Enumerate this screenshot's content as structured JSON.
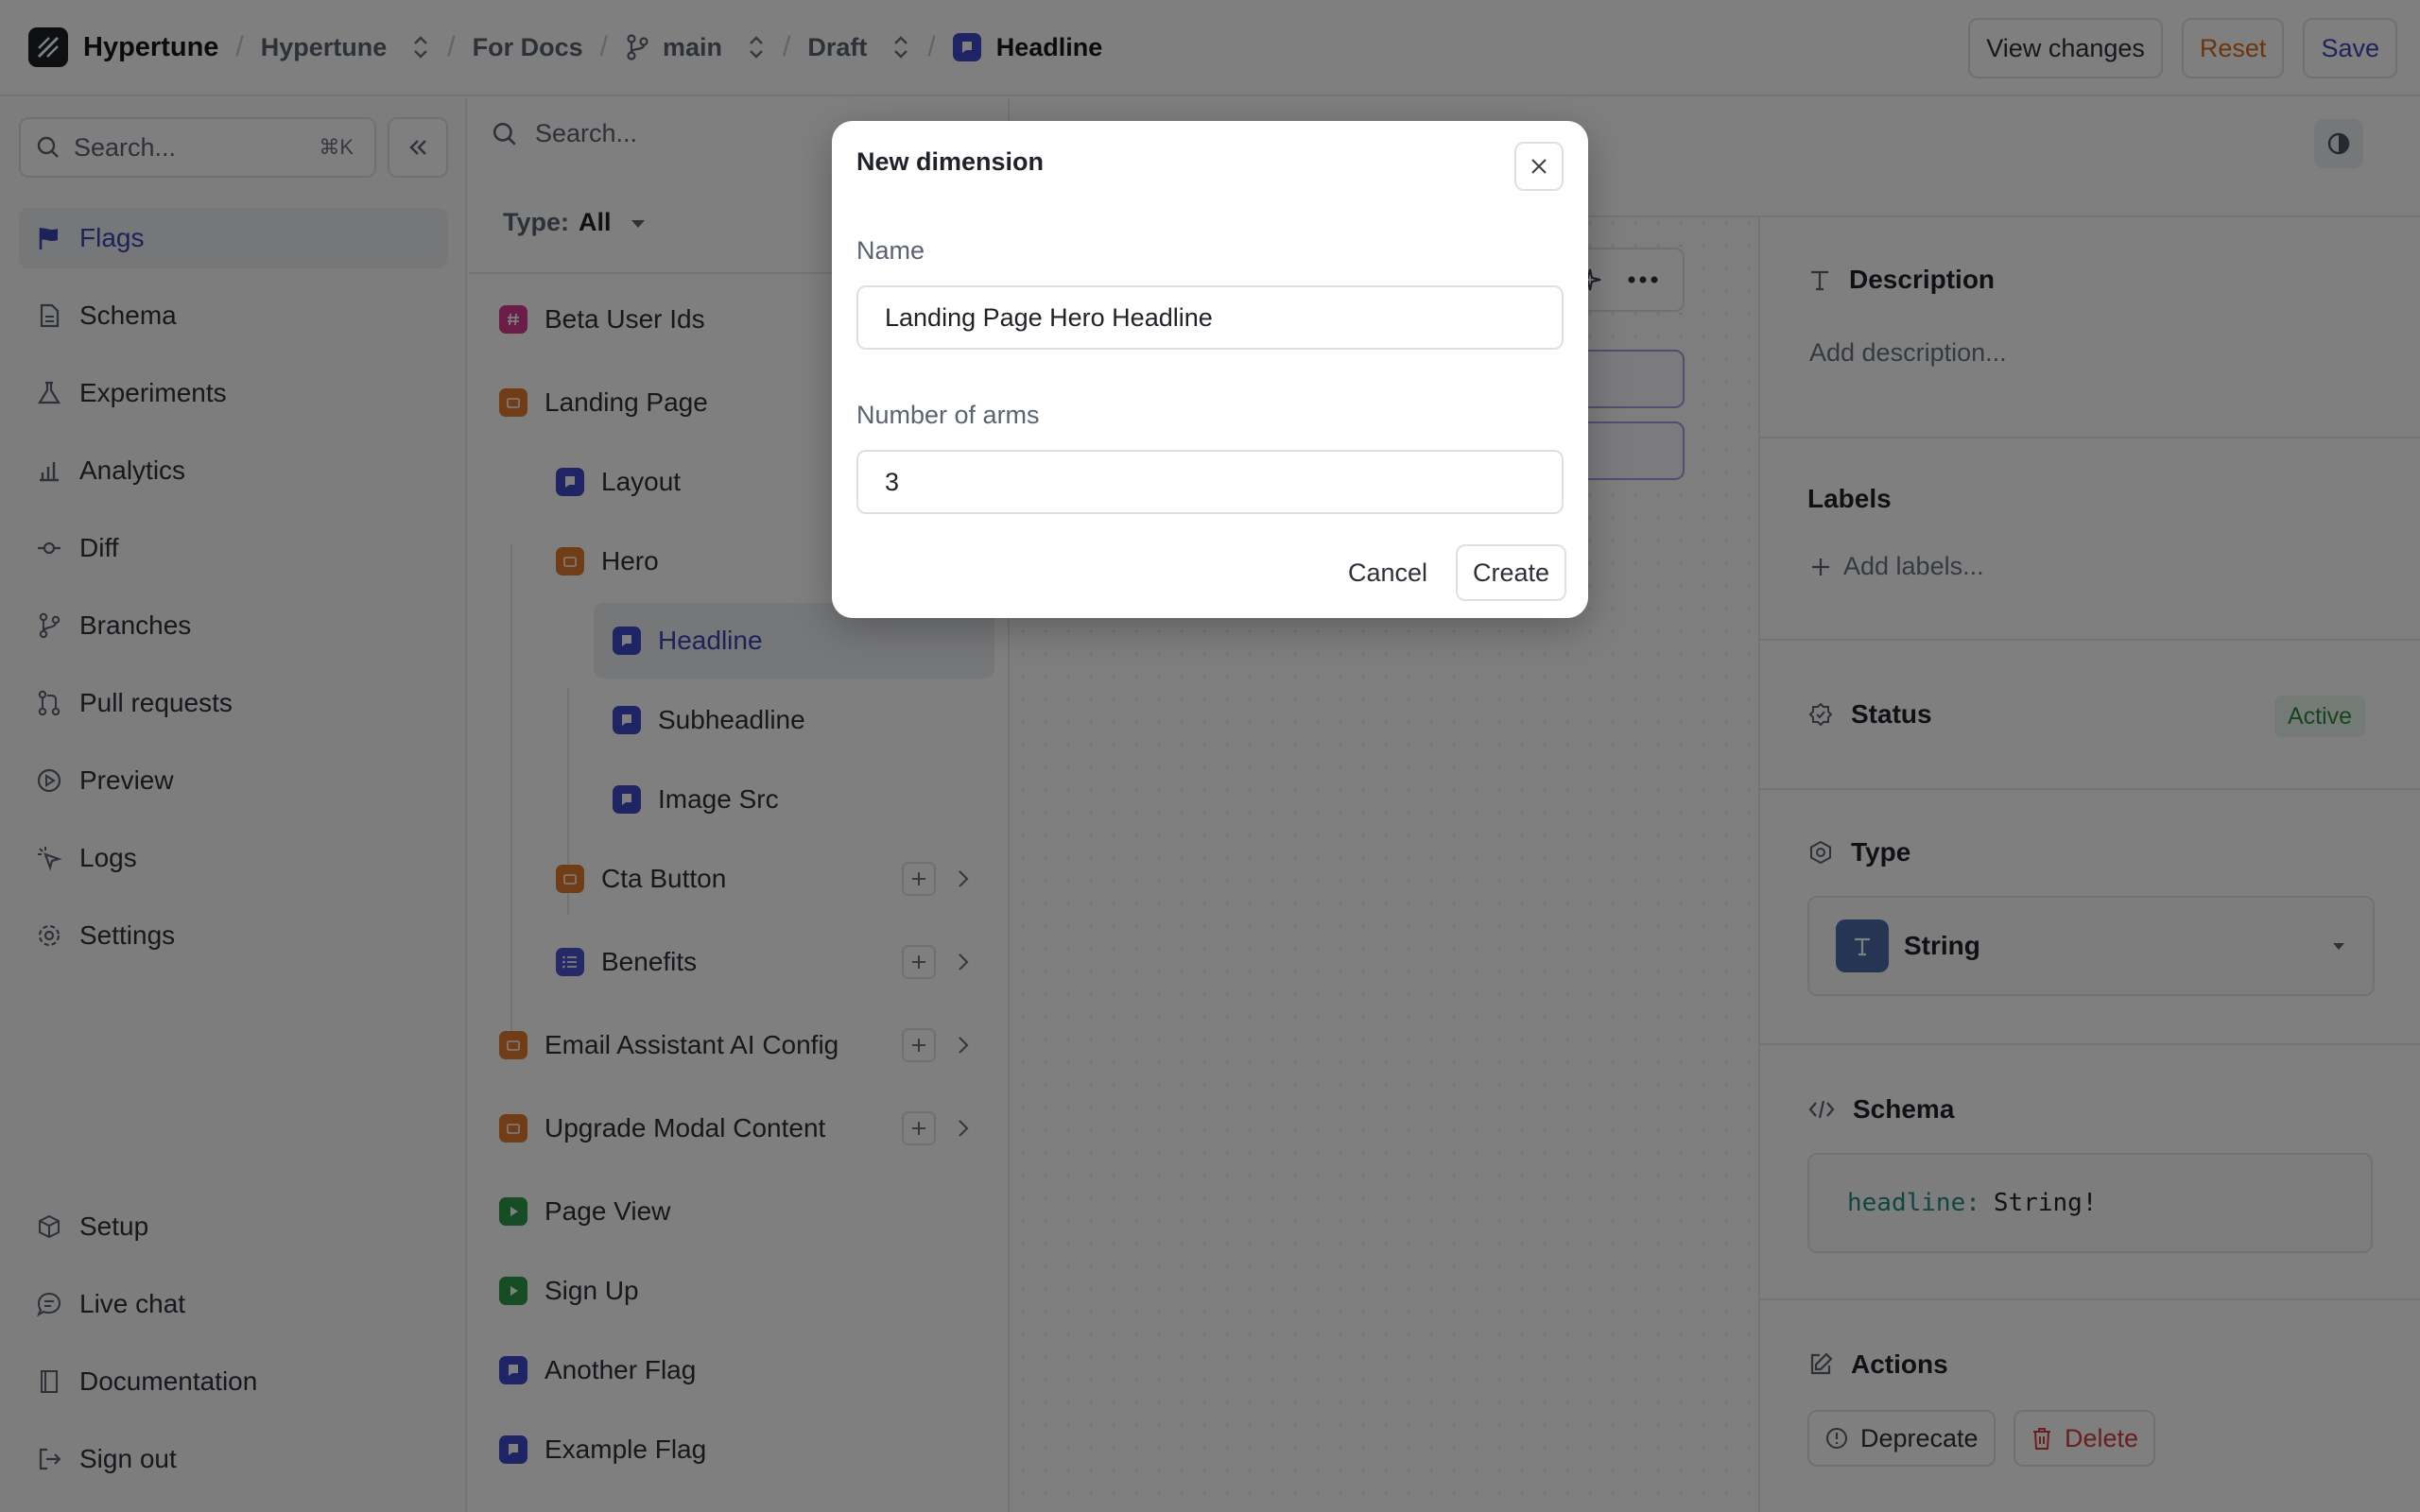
{
  "topbar": {
    "app_name": "Hypertune",
    "project": "Hypertune",
    "section": "For Docs",
    "branch": "main",
    "state": "Draft",
    "current_flag": "Headline",
    "view_changes": "View changes",
    "reset": "Reset",
    "save": "Save"
  },
  "sidebar": {
    "search_placeholder": "Search...",
    "search_shortcut": "⌘K",
    "items": [
      {
        "label": "Flags"
      },
      {
        "label": "Schema"
      },
      {
        "label": "Experiments"
      },
      {
        "label": "Analytics"
      },
      {
        "label": "Diff"
      },
      {
        "label": "Branches"
      },
      {
        "label": "Pull requests"
      },
      {
        "label": "Preview"
      },
      {
        "label": "Logs"
      },
      {
        "label": "Settings"
      }
    ],
    "bottom_items": [
      {
        "label": "Setup"
      },
      {
        "label": "Live chat"
      },
      {
        "label": "Documentation"
      },
      {
        "label": "Sign out"
      }
    ]
  },
  "tree": {
    "search_placeholder": "Search...",
    "type_label": "Type:",
    "type_value": "All",
    "nodes": [
      {
        "label": "Beta User Ids"
      },
      {
        "label": "Landing Page"
      },
      {
        "label": "Layout"
      },
      {
        "label": "Hero"
      },
      {
        "label": "Headline"
      },
      {
        "label": "Subheadline"
      },
      {
        "label": "Image Src"
      },
      {
        "label": "Cta Button"
      },
      {
        "label": "Benefits"
      },
      {
        "label": "Email Assistant AI Config"
      },
      {
        "label": "Upgrade Modal Content"
      },
      {
        "label": "Page View"
      },
      {
        "label": "Sign Up"
      },
      {
        "label": "Another Flag"
      },
      {
        "label": "Example Flag"
      }
    ]
  },
  "details": {
    "description_title": "Description",
    "description_placeholder": "Add description...",
    "labels_title": "Labels",
    "add_labels": "Add labels...",
    "status_title": "Status",
    "status_value": "Active",
    "type_title": "Type",
    "type_value": "String",
    "schema_title": "Schema",
    "schema_key": "headline",
    "schema_value": "String!",
    "actions_title": "Actions",
    "deprecate": "Deprecate",
    "delete": "Delete"
  },
  "modal": {
    "title": "New dimension",
    "name_label": "Name",
    "name_value": "Landing Page Hero Headline",
    "arms_label": "Number of arms",
    "arms_value": "3",
    "cancel": "Cancel",
    "create": "Create"
  },
  "colors": {
    "accent": "#3a46b5",
    "flag_icon": "#3f48c9",
    "folder_icon": "#e07a2c",
    "event_icon": "#2e9a4a",
    "number_icon": "#d43a8e",
    "status_active": "#2e8a44",
    "delete": "#d43c3c",
    "reset": "#d96b1a"
  }
}
